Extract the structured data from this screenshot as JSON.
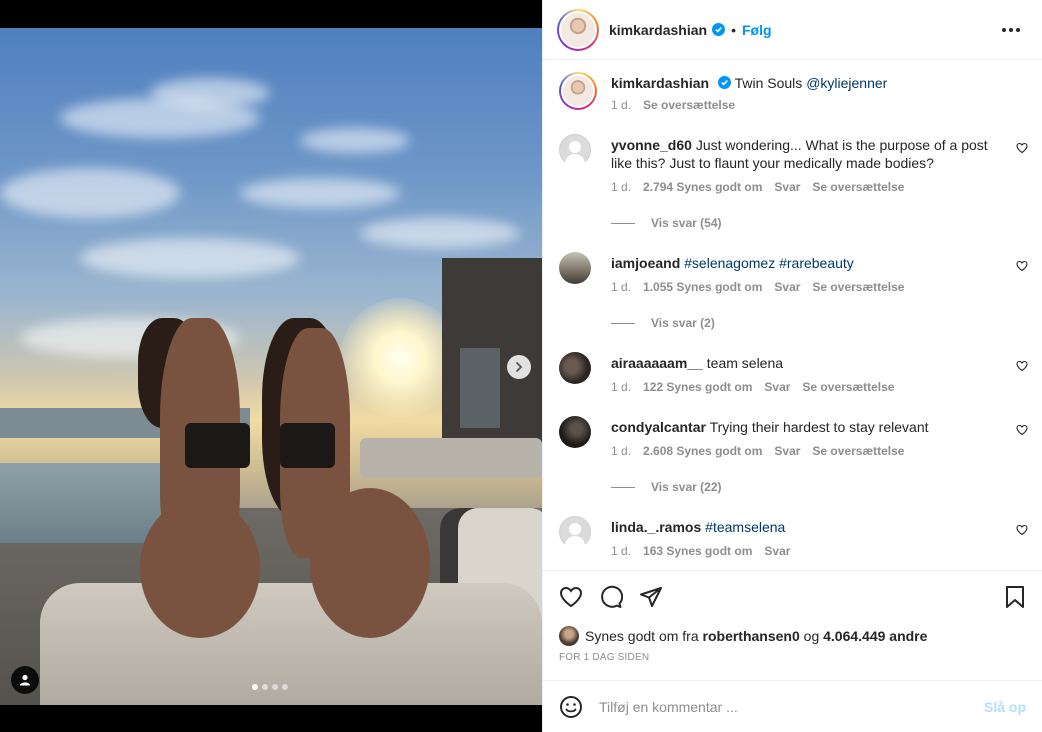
{
  "header": {
    "username": "kimkardashian",
    "separator": "•",
    "follow_label": "Følg"
  },
  "caption": {
    "username": "kimkardashian",
    "text": "Twin Souls",
    "mention": "@kyliejenner",
    "time": "1 d.",
    "translate": "Se oversættelse"
  },
  "comments": [
    {
      "username": "yvonne_d60",
      "text": "Just wondering... What is the purpose of a post like this? Just to flaunt your medically made bodies?",
      "time": "1 d.",
      "likes": "2.794 Synes godt om",
      "reply": "Svar",
      "translate": "Se oversættelse",
      "replies": "Vis svar (54)"
    },
    {
      "username": "iamjoeand",
      "text": "",
      "tags": "#selenagomez #rarebeauty",
      "time": "1 d.",
      "likes": "1.055 Synes godt om",
      "reply": "Svar",
      "translate": "Se oversættelse",
      "replies": "Vis svar (2)"
    },
    {
      "username": "airaaaaaam__",
      "text": "team selena",
      "time": "1 d.",
      "likes": "122 Synes godt om",
      "reply": "Svar",
      "translate": "Se oversættelse"
    },
    {
      "username": "condyalcantar",
      "text": "Trying their hardest to stay relevant",
      "time": "1 d.",
      "likes": "2.608 Synes godt om",
      "reply": "Svar",
      "translate": "Se oversættelse",
      "replies": "Vis svar (22)"
    },
    {
      "username": "linda._.ramos",
      "text": "",
      "tags": "#teamselena",
      "time": "1 d.",
      "likes": "163 Synes godt om",
      "reply": "Svar"
    }
  ],
  "likes": {
    "prefix": "Synes godt om fra",
    "user": "roberthansen0",
    "connector": "og",
    "others": "4.064.449 andre"
  },
  "posted_time": "FOR 1 DAG SIDEN",
  "add_comment": {
    "placeholder": "Tilføj en kommentar ...",
    "post_label": "Slå op"
  },
  "media": {
    "slides": 4,
    "active_slide": 1
  },
  "colors": {
    "accent": "#0095f6",
    "post_disabled": "#b2dffc",
    "muted": "#8e8e8e",
    "text": "#262626"
  }
}
